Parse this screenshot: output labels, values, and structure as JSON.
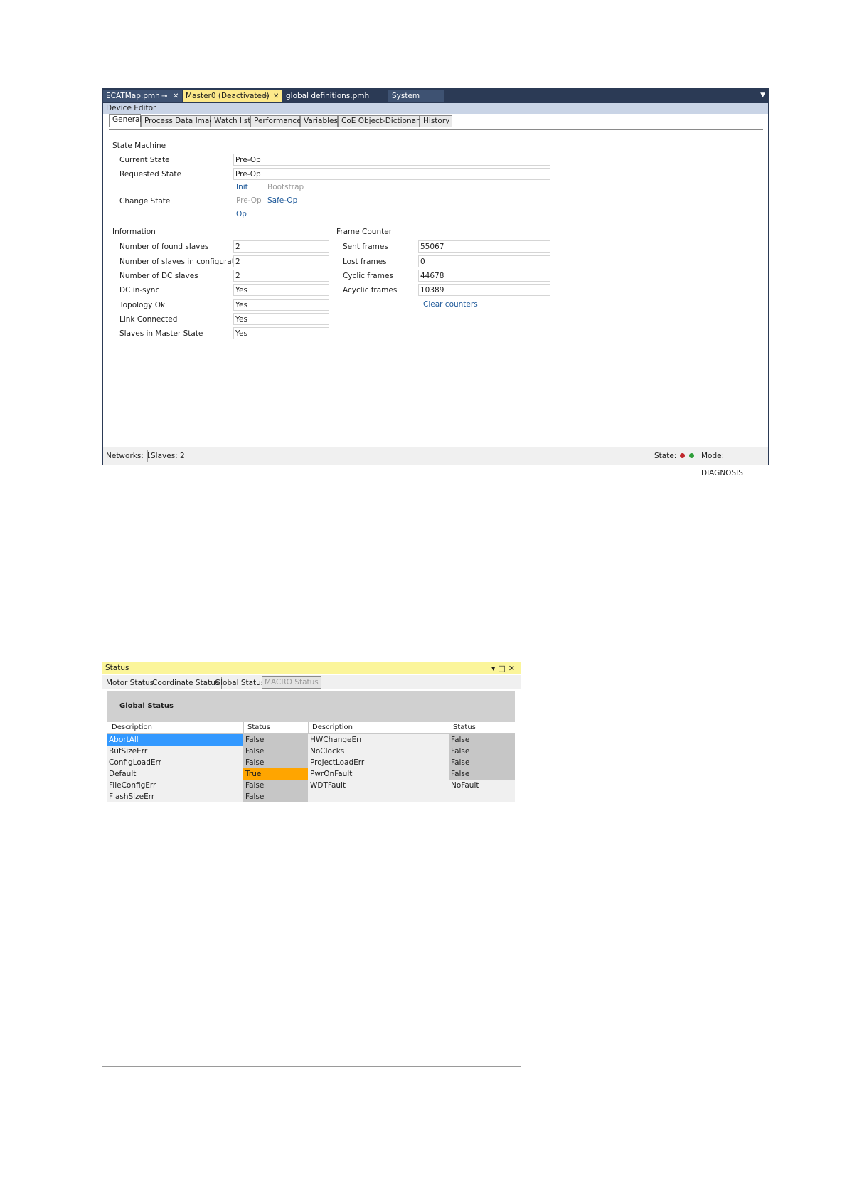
{
  "doc_tabs": [
    {
      "label": "ECATMap.pmh"
    },
    {
      "label": "Master0 (Deactivated)"
    },
    {
      "label": "global definitions.pmh"
    },
    {
      "label": "System"
    }
  ],
  "device_editor": {
    "panel_title": "Device Editor",
    "tabs": [
      "General",
      "Process Data Image",
      "Watch list",
      "Performance",
      "Variables",
      "CoE Object-Dictionary",
      "History"
    ],
    "state_machine": {
      "title": "State Machine",
      "current_state_label": "Current State",
      "current_state_value": "Pre-Op",
      "requested_state_label": "Requested State",
      "requested_state_value": "Pre-Op",
      "change_state_label": "Change State",
      "buttons": {
        "init": "Init",
        "bootstrap": "Bootstrap",
        "preop": "Pre-Op",
        "safeop": "Safe-Op",
        "op": "Op"
      }
    },
    "information": {
      "title": "Information",
      "rows": [
        {
          "label": "Number of found slaves",
          "value": "2"
        },
        {
          "label": "Number of slaves in configuration",
          "value": "2"
        },
        {
          "label": "Number of DC slaves",
          "value": "2"
        },
        {
          "label": "DC in-sync",
          "value": "Yes"
        },
        {
          "label": "Topology Ok",
          "value": "Yes"
        },
        {
          "label": "Link Connected",
          "value": "Yes"
        },
        {
          "label": "Slaves in Master State",
          "value": "Yes"
        }
      ]
    },
    "frame_counter": {
      "title": "Frame Counter",
      "rows": [
        {
          "label": "Sent frames",
          "value": "55067"
        },
        {
          "label": "Lost frames",
          "value": "0"
        },
        {
          "label": "Cyclic frames",
          "value": "44678"
        },
        {
          "label": "Acyclic frames",
          "value": "10389"
        }
      ],
      "clear_label": "Clear counters"
    },
    "statusbar": {
      "networks": "Networks: 1",
      "slaves": "Slaves: 2",
      "state": "State:",
      "mode": "Mode: DIAGNOSIS",
      "state_dot_colors": [
        "#c0282d",
        "#2e9e3a"
      ]
    }
  },
  "status_window": {
    "title": "Status",
    "tabs": [
      "Motor Status",
      "Coordinate Status",
      "Global Status",
      "MACRO Status"
    ],
    "section_title": "Global Status",
    "columns": [
      "Description",
      "Status",
      "Description",
      "Status"
    ],
    "left_rows": [
      {
        "desc": "AbortAll",
        "status": "False"
      },
      {
        "desc": "BufSizeErr",
        "status": "False"
      },
      {
        "desc": "ConfigLoadErr",
        "status": "False"
      },
      {
        "desc": "Default",
        "status": "True"
      },
      {
        "desc": "FileConfigErr",
        "status": "False"
      },
      {
        "desc": "FlashSizeErr",
        "status": "False"
      }
    ],
    "right_rows": [
      {
        "desc": "HWChangeErr",
        "status": "False"
      },
      {
        "desc": "NoClocks",
        "status": "False"
      },
      {
        "desc": "ProjectLoadErr",
        "status": "False"
      },
      {
        "desc": "PwrOnFault",
        "status": "False"
      },
      {
        "desc": "WDTFault",
        "status": "NoFault"
      }
    ],
    "colors": {
      "selected": "#3399ff",
      "true_highlight": "#ffa500",
      "status_cell": "#c6c6c6"
    }
  }
}
